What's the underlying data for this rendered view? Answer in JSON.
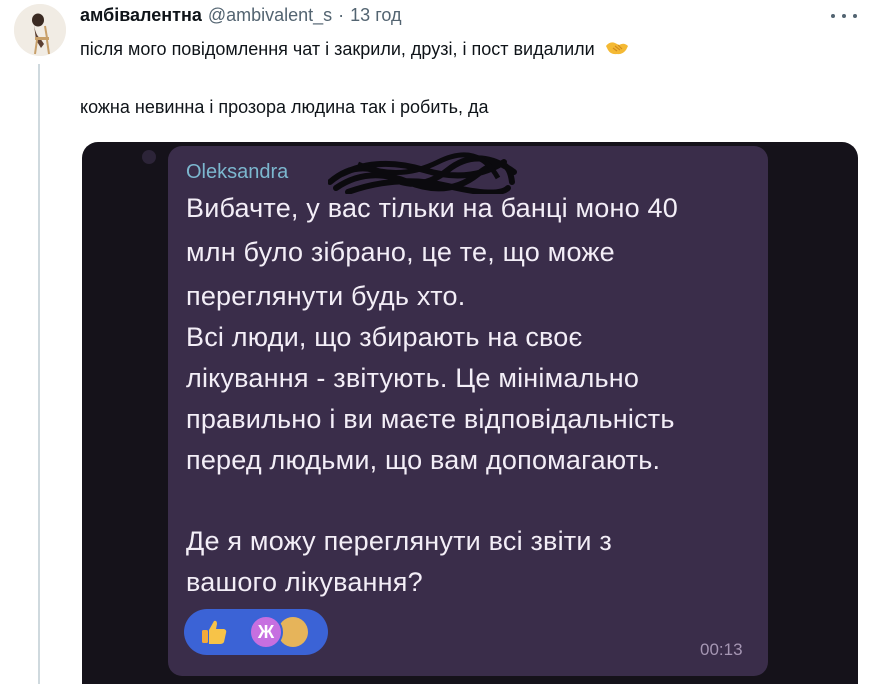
{
  "author": {
    "display_name": "амбівалентна",
    "handle": "@ambivalent_s",
    "separator": "·",
    "time": "13 год"
  },
  "tweet": {
    "text_line1": "після мого повідомлення чат і закрили, друзі, і пост видалили",
    "text_line1_emoji": "handshake-emoji",
    "text_line2": "кожна невинна і прозора людина так і робить, да"
  },
  "media": {
    "sender": "Oleksandra",
    "message_lines": [
      "Вибачте, у вас тільки на банці моно 40",
      "млн було зібрано, це те, що може",
      "переглянути будь хто.",
      "Всі люди, що збирають на своє",
      "лікування - звітують. Це мінімально",
      "правильно і ви маєте відповідальність",
      "перед людьми, що вам допомагають.",
      "Де я можу переглянути всі звіти з",
      "вашого лікування?"
    ],
    "reactions": [
      "thumbs-up-icon",
      "zh-avatar",
      "coin-avatar"
    ],
    "reaction_avatar_letter": "Ж",
    "time": "00:13"
  },
  "colors": {
    "bubble": "#3a2d4a",
    "sender": "#7cb7cf",
    "reactions_pill": "#3b63d6",
    "handle_gray": "#536471"
  }
}
